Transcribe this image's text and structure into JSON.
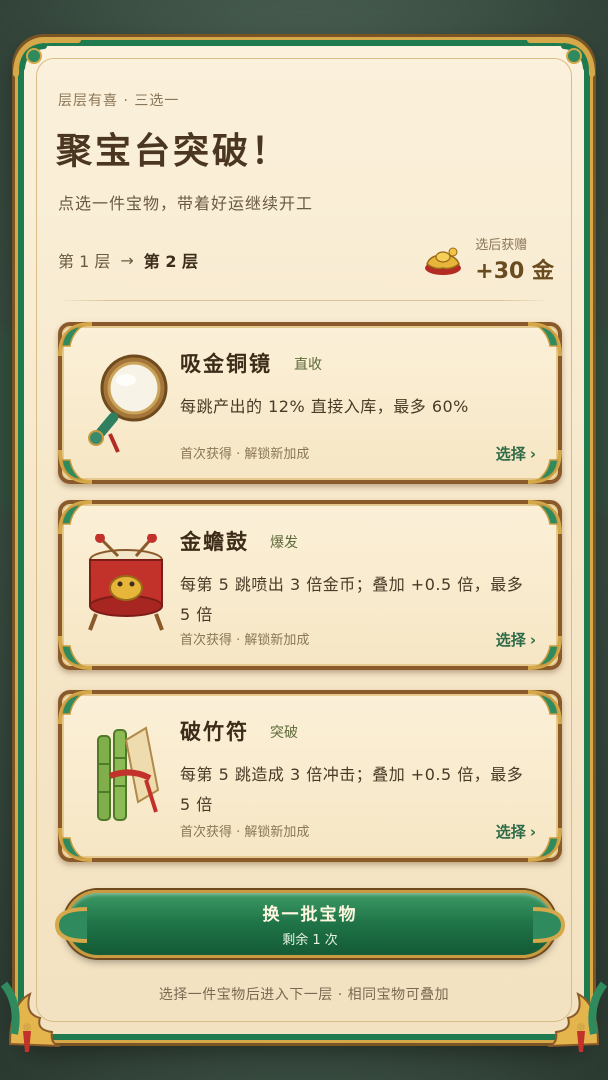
{
  "header": {
    "subtitle": "层层有喜 · 三选一",
    "title": "聚宝台突破！",
    "description": "点选一件宝物，带着好运继续开工",
    "floor_from": "第 1 层",
    "arrow": "→",
    "floor_to": "第 2 层",
    "reward_label": "选后获赠",
    "reward_amount": "+30 金"
  },
  "cards": [
    {
      "name": "吸金铜镜",
      "tag": "直收",
      "effect": "每跳产出的 12% 直接入库，最多 60%",
      "meta": "首次获得 · 解锁新加成",
      "select": "选择",
      "icon": "bronze-mirror-icon"
    },
    {
      "name": "金蟾鼓",
      "tag": "爆发",
      "effect": "每第 5 跳喷出 3 倍金币；叠加 +0.5 倍，最多 5 倍",
      "meta": "首次获得 · 解锁新加成",
      "select": "选择",
      "icon": "golden-toad-drum-icon"
    },
    {
      "name": "破竹符",
      "tag": "突破",
      "effect": "每第 5 跳造成 3 倍冲击；叠加 +0.5 倍，最多 5 倍",
      "meta": "首次获得 · 解锁新加成",
      "select": "选择",
      "icon": "bamboo-talisman-icon"
    }
  ],
  "refresh": {
    "label": "换一批宝物",
    "remaining": "剩余 1 次"
  },
  "footer": "选择一件宝物后进入下一层 · 相同宝物可叠加",
  "colors": {
    "parchment": "#f6e7c9",
    "jade": "#1f7a4f",
    "gold": "#d5a849",
    "title_text": "#4a3621",
    "select_text": "#2f6b48"
  }
}
